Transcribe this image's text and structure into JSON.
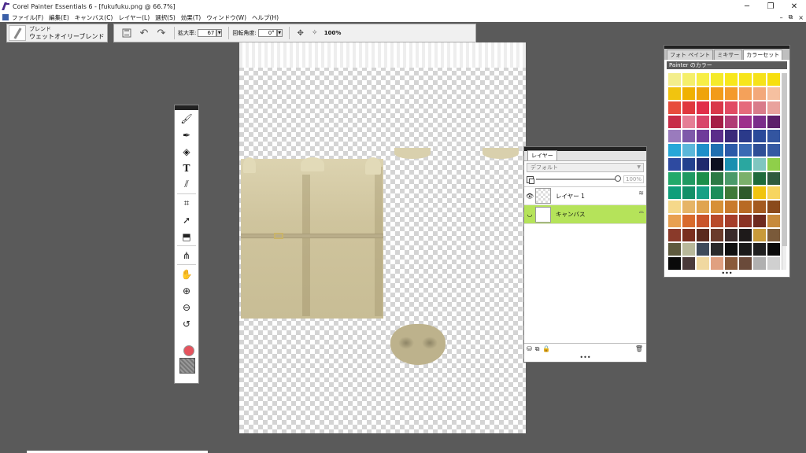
{
  "window": {
    "title": "Corel Painter Essentials 6 - [fukufuku.png @ 66.7%]",
    "controls": [
      "─",
      "❐",
      "✕"
    ]
  },
  "menu": {
    "items": [
      "ファイル(F)",
      "編集(E)",
      "キャンバス(C)",
      "レイヤー(L)",
      "選択(S)",
      "効果(T)",
      "ウィンドウ(W)",
      "ヘルプ(H)"
    ],
    "mdi_controls": [
      "–",
      "⧉",
      "×"
    ]
  },
  "brush": {
    "category": "ブレンド",
    "variant": "ウェットオイリーブレンド"
  },
  "propbar": {
    "zoom_label": "拡大率:",
    "zoom_value": "67",
    "rotation_label": "回転角度:",
    "rotation_value": "0°",
    "actual_size": "100%"
  },
  "toolbox": {
    "tools": [
      "brush-icon",
      "dropper-icon",
      "paint-bucket-icon",
      "text-icon",
      "blender-icon",
      "crop-icon",
      "transform-icon",
      "shape-icon",
      "mirror-icon",
      "grabber-icon",
      "zoom-in-icon",
      "zoom-out-icon",
      "rotate-icon"
    ],
    "main_color": "#e5535d"
  },
  "layers": {
    "tab": "レイヤー",
    "blend_mode": "デフォルト",
    "opacity": "100%",
    "opacity_fraction": 1.0,
    "rows": [
      {
        "name": "レイヤー 1",
        "selected": false
      },
      {
        "name": "キャンバス",
        "selected": true
      }
    ],
    "highlight_color": "#b5e35a"
  },
  "colorset": {
    "tabs": [
      "フォト ペイント",
      "ミキサー",
      "カラーセット"
    ],
    "active_tab": "カラーセット",
    "library_name": "Painter のカラー",
    "swatches": [
      "#f3ee8c",
      "#f5ef6a",
      "#f7ee45",
      "#f5ea2a",
      "#f8e71c",
      "#f7e51b",
      "#f6e21a",
      "#f7df0f",
      "#f1c40f",
      "#f0b100",
      "#efa40b",
      "#f29b1a",
      "#f49a2b",
      "#f4a15a",
      "#f3a87a",
      "#f6c0a0",
      "#e74c3c",
      "#e0383e",
      "#e12e4a",
      "#d9384a",
      "#e14a63",
      "#e56a7c",
      "#d97b8a",
      "#e9a29d",
      "#c72c48",
      "#e57d95",
      "#d8456b",
      "#a51d46",
      "#b03a75",
      "#9d2e8c",
      "#7b2d8a",
      "#5d1f6a",
      "#9a7bbd",
      "#7e59aa",
      "#6f3c9a",
      "#5b2d8a",
      "#3a2a7a",
      "#2b3a8a",
      "#2a4a9a",
      "#3355a0",
      "#26a7d8",
      "#5bb7da",
      "#1e8fc9",
      "#1f6fb0",
      "#2b5aa8",
      "#3a6ab4",
      "#2e4e96",
      "#3559a3",
      "#2e4aa0",
      "#23418e",
      "#1f2a6e",
      "#0c1020",
      "#1a8fb0",
      "#2aa7a0",
      "#7fc6c0",
      "#8fcf4a",
      "#21a96a",
      "#1f9a62",
      "#1b8e4a",
      "#2c7a45",
      "#4a9a6a",
      "#7ab06a",
      "#1e6a3a",
      "#2e5a3e",
      "#0f9e7a",
      "#139068",
      "#16a085",
      "#1d8e5a",
      "#3f7a38",
      "#2f5b2a",
      "#f1c40f",
      "#f7d560",
      "#f5d88a",
      "#e6b466",
      "#e0a450",
      "#d79037",
      "#c97a2c",
      "#b86a24",
      "#a45a20",
      "#8a4a1c",
      "#e8a050",
      "#d86a2c",
      "#c9542a",
      "#b84a2a",
      "#a53d2a",
      "#8a3324",
      "#6e2a1e",
      "#c78a3c",
      "#8a3a2a",
      "#7a3020",
      "#5a2a1e",
      "#6a3a2a",
      "#3a2a2a",
      "#1e1a1a",
      "#c89a3a",
      "#7a5a3a",
      "#5e5a3e",
      "#b8b89a",
      "#3e4a5a",
      "#2a2a2a",
      "#101010",
      "#1a1a1a",
      "#202020",
      "#0a0a0a",
      "#0a0a0a",
      "#4a3a3a",
      "#f0d8a0",
      "#e0a080",
      "#8a5a3a",
      "#6a4a3a",
      "#b0b0b0",
      "#d0d0d0"
    ]
  }
}
